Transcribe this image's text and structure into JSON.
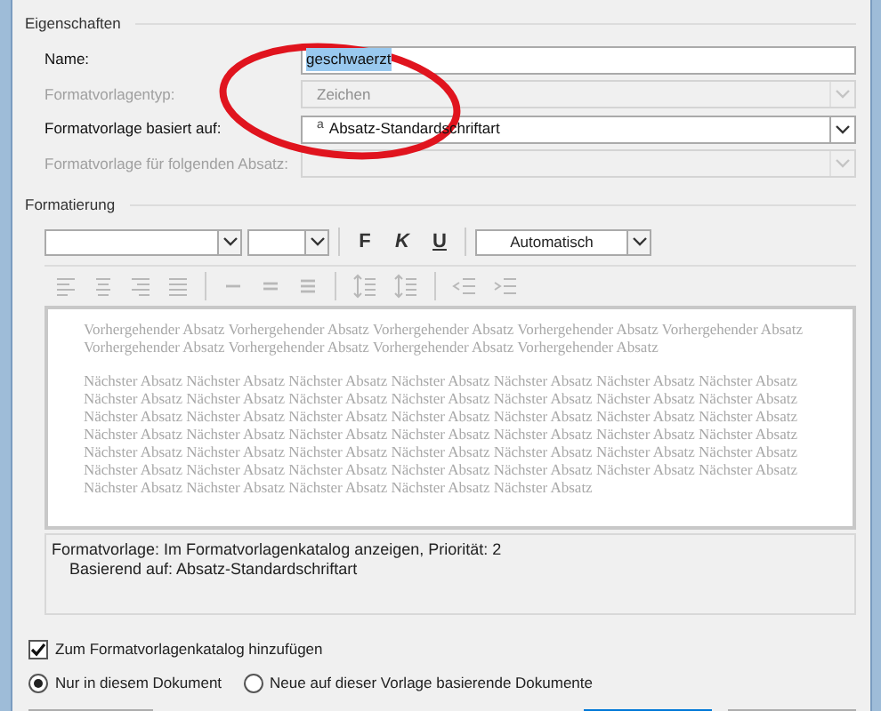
{
  "properties": {
    "title": "Eigenschaften",
    "fields": [
      {
        "label": "Name:",
        "kind": "text",
        "value": "geschwaerzt",
        "highlighted": true,
        "disabled": false
      },
      {
        "label": "Formatvorlagentyp:",
        "kind": "dropdown",
        "value": "Zeichen",
        "disabled": true
      },
      {
        "label": "Formatvorlage basiert auf:",
        "kind": "dropdown",
        "marker": "a",
        "value": "Absatz-Standardschriftart",
        "disabled": false
      },
      {
        "label": "Formatvorlage für folgenden Absatz:",
        "kind": "dropdown",
        "disabled": true
      }
    ]
  },
  "formatting": {
    "title": "Formatierung",
    "bold": "F",
    "italic": "K",
    "underline": "U",
    "color_name": "Automatisch",
    "paragraph_tools_disabled": true
  },
  "preview": {
    "previous": "Vorhergehender Absatz Vorhergehender Absatz Vorhergehender Absatz Vorhergehender Absatz Vorhergehender Absatz Vorhergehender Absatz Vorhergehender Absatz Vorhergehender Absatz Vorhergehender Absatz",
    "next": "Nächster Absatz Nächster Absatz Nächster Absatz Nächster Absatz Nächster Absatz Nächster Absatz Nächster Absatz Nächster Absatz Nächster Absatz Nächster Absatz Nächster Absatz Nächster Absatz Nächster Absatz Nächster Absatz Nächster Absatz Nächster Absatz Nächster Absatz Nächster Absatz Nächster Absatz Nächster Absatz Nächster Absatz Nächster Absatz Nächster Absatz Nächster Absatz Nächster Absatz Nächster Absatz Nächster Absatz Nächster Absatz Nächster Absatz Nächster Absatz Nächster Absatz Nächster Absatz Nächster Absatz Nächster Absatz Nächster Absatz Nächster Absatz Nächster Absatz Nächster Absatz Nächster Absatz Nächster Absatz Nächster Absatz Nächster Absatz Nächster Absatz Nächster Absatz Nächster Absatz Nächster Absatz Nächster Absatz"
  },
  "description": [
    "Formatvorlage: Im Formatvorlagenkatalog anzeigen, Priorität: 2",
    "Basierend auf: Absatz-Standardschriftart"
  ],
  "add_to_gallery": {
    "label": "Zum Formatvorlagenkatalog hinzufügen",
    "checked": true
  },
  "scope": [
    {
      "label": "Nur in diesem Dokument",
      "selected": true
    },
    {
      "label": "Neue auf dieser Vorlage basierende Dokumente",
      "selected": false
    }
  ]
}
